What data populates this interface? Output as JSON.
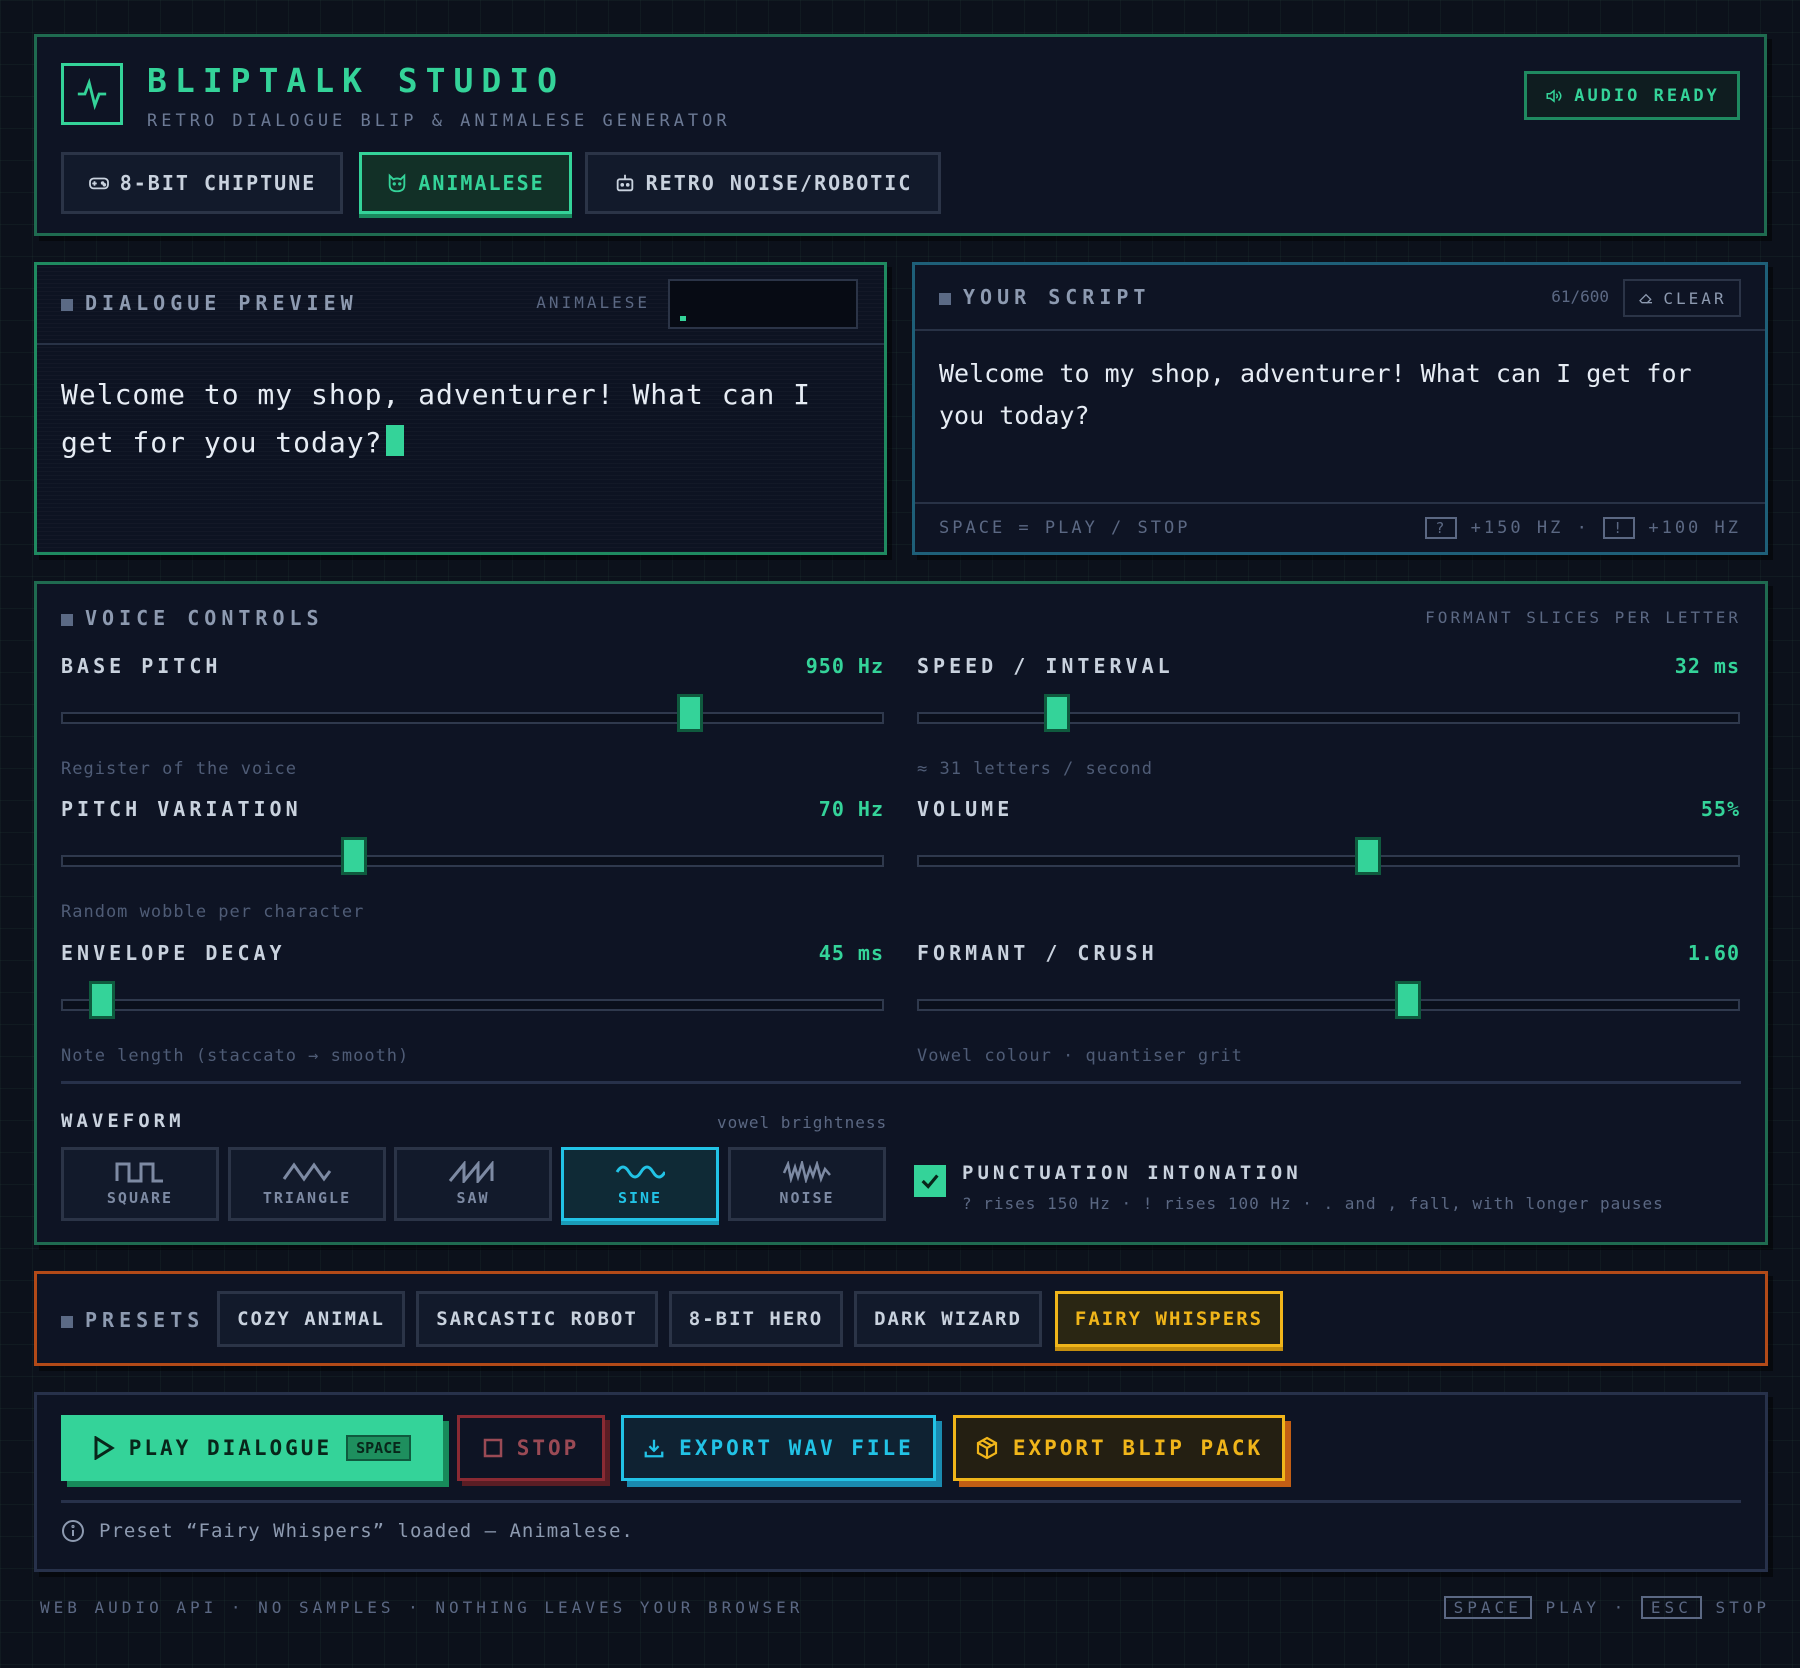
{
  "header": {
    "title": "BLIPTALK STUDIO",
    "subtitle": "RETRO DIALOGUE BLIP & ANIMALESE GENERATOR",
    "status_badge": "AUDIO READY",
    "modes": [
      {
        "label": "8-BIT CHIPTUNE",
        "icon": "gamepad-icon",
        "active": false
      },
      {
        "label": "ANIMALESE",
        "icon": "cat-icon",
        "active": true
      },
      {
        "label": "RETRO NOISE/ROBOTIC",
        "icon": "robot-icon",
        "active": false
      }
    ]
  },
  "preview": {
    "title": "DIALOGUE PREVIEW",
    "mode_label": "ANIMALESE",
    "text": "Welcome to my shop, adventurer! What can I get for you today?"
  },
  "script": {
    "title": "YOUR SCRIPT",
    "char_count": "61/600",
    "clear_label": "CLEAR",
    "text": "Welcome to my shop, adventurer! What can I get for you today?",
    "hint_play": "SPACE = PLAY / STOP",
    "hint_q_key": "?",
    "hint_q": "+150 HZ",
    "hint_sep": "·",
    "hint_ex_key": "!",
    "hint_ex": "+100 HZ"
  },
  "controls": {
    "title": "VOICE CONTROLS",
    "note": "FORMANT SLICES PER LETTER",
    "sliders": [
      {
        "label": "BASE PITCH",
        "value": "950 Hz",
        "help": "Register of the voice",
        "fraction": 0.765
      },
      {
        "label": "SPEED / INTERVAL",
        "value": "32 ms",
        "help": "≈ 31 letters / second",
        "fraction": 0.169
      },
      {
        "label": "PITCH VARIATION",
        "value": "70 Hz",
        "help": "Random wobble per character",
        "fraction": 0.355
      },
      {
        "label": "VOLUME",
        "value": "55%",
        "help": "",
        "fraction": 0.548
      },
      {
        "label": "ENVELOPE DECAY",
        "value": "45 ms",
        "help": "Note length (staccato → smooth)",
        "fraction": 0.048
      },
      {
        "label": "FORMANT / CRUSH",
        "value": "1.60",
        "help": "Vowel colour · quantiser grit",
        "fraction": 0.597
      }
    ],
    "waveform_label": "WAVEFORM",
    "waveform_note": "vowel brightness",
    "waveforms": [
      {
        "label": "SQUARE",
        "icon": "square-wave-icon",
        "active": false
      },
      {
        "label": "TRIANGLE",
        "icon": "triangle-wave-icon",
        "active": false
      },
      {
        "label": "SAW",
        "icon": "saw-wave-icon",
        "active": false
      },
      {
        "label": "SINE",
        "icon": "sine-wave-icon",
        "active": true
      },
      {
        "label": "NOISE",
        "icon": "noise-wave-icon",
        "active": false
      }
    ],
    "intonation_label": "PUNCTUATION INTONATION",
    "intonation_help": "? rises 150 Hz · ! rises 100 Hz · . and , fall, with longer pauses",
    "intonation_checked": true
  },
  "presets": {
    "title": "PRESETS",
    "items": [
      {
        "label": "COZY ANIMAL",
        "active": false
      },
      {
        "label": "SARCASTIC ROBOT",
        "active": false
      },
      {
        "label": "8-BIT HERO",
        "active": false
      },
      {
        "label": "DARK WIZARD",
        "active": false
      },
      {
        "label": "FAIRY WHISPERS",
        "active": true
      }
    ]
  },
  "actions": {
    "play": "PLAY DIALOGUE",
    "play_key": "SPACE",
    "stop": "STOP",
    "export_wav": "EXPORT WAV FILE",
    "export_pack": "EXPORT BLIP PACK",
    "status": "Preset “Fairy Whispers” loaded — Animalese."
  },
  "footer": {
    "left": "WEB AUDIO API · NO SAMPLES · NOTHING LEAVES YOUR BROWSER",
    "key1": "SPACE",
    "key1_label": "PLAY",
    "sep": "·",
    "key2": "ESC",
    "key2_label": "STOP"
  },
  "colors": {
    "accent": "#34d399",
    "cyan": "#22c3e6",
    "amber": "#f0b51a",
    "danger": "#8a2a33"
  }
}
